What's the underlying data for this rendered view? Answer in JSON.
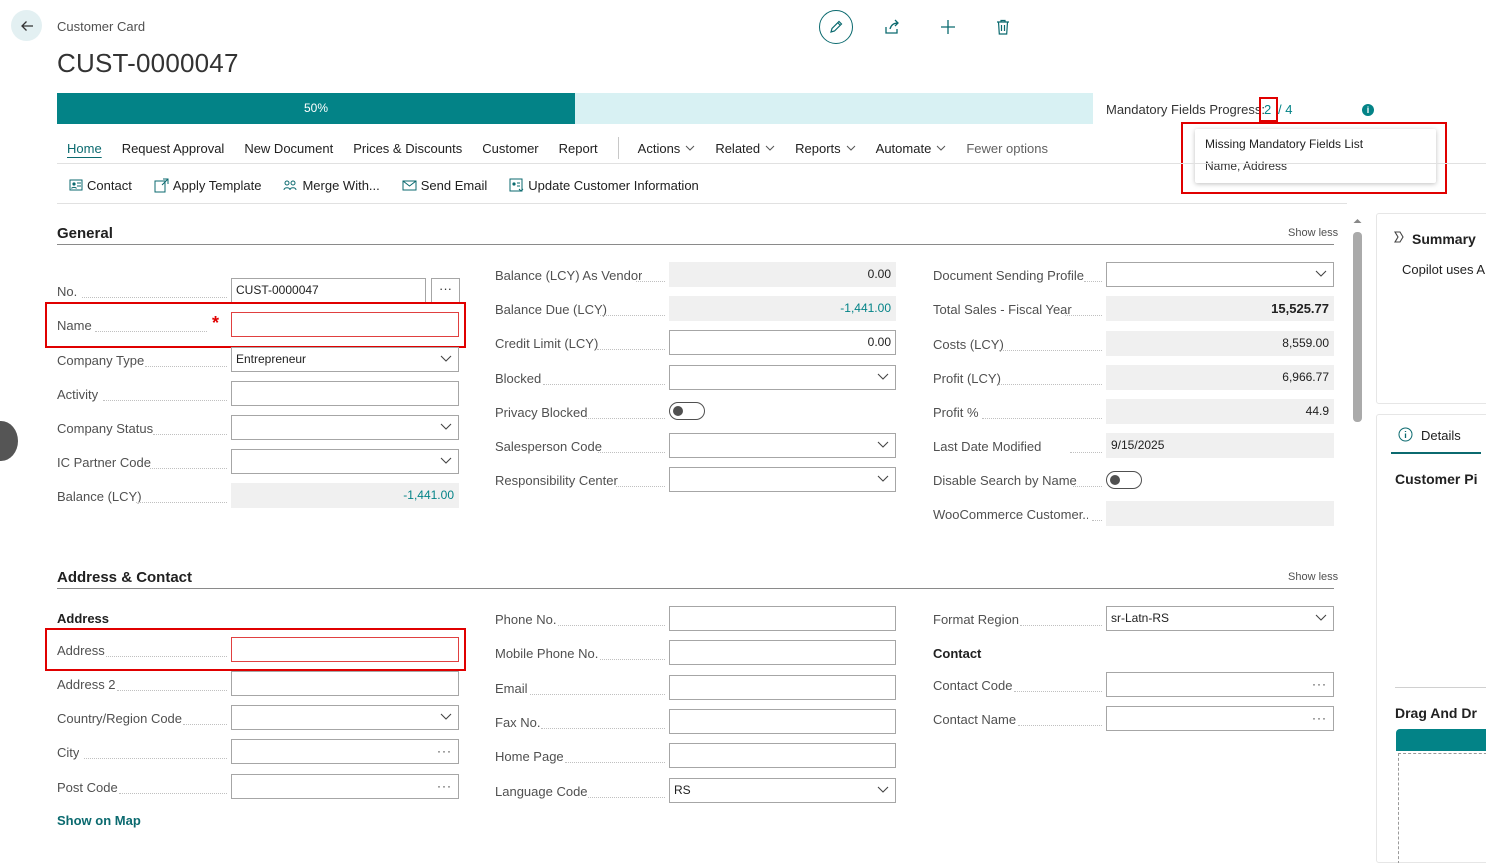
{
  "header": {
    "card_type": "Customer Card",
    "title": "CUST-0000047"
  },
  "icons": {
    "back": "arrow-left-icon",
    "edit": "pencil-icon",
    "share": "share-icon",
    "new": "plus-icon",
    "delete": "trash-icon"
  },
  "progress": {
    "percent": 50,
    "label": "50%",
    "mandatory_label": "Mandatory Fields Progress:",
    "filled": "2",
    "total": "/ 4",
    "info": "i"
  },
  "tooltip": {
    "title": "Missing Mandatory Fields List",
    "body": "Name, Address"
  },
  "tabs": {
    "home": "Home",
    "request_approval": "Request Approval",
    "new_document": "New Document",
    "prices_discounts": "Prices & Discounts",
    "customer": "Customer",
    "report": "Report",
    "actions": "Actions",
    "related": "Related",
    "reports": "Reports",
    "automate": "Automate",
    "fewer": "Fewer options"
  },
  "actions": {
    "contact": "Contact",
    "apply_template": "Apply Template",
    "merge_with": "Merge With...",
    "send_email": "Send Email",
    "update_info": "Update Customer Information"
  },
  "general": {
    "title": "General",
    "show_less": "Show less",
    "no_label": "No.",
    "no_value": "CUST-0000047",
    "more": "···",
    "name_label": "Name",
    "required": "*",
    "name_value": "",
    "company_type_label": "Company Type",
    "company_type_value": "Entrepreneur",
    "activity_label": "Activity",
    "company_status_label": "Company Status",
    "ic_partner_label": "IC Partner Code",
    "balance_label": "Balance (LCY)",
    "balance_value": "-1,441.00",
    "bal_vendor_label": "Balance (LCY) As Vendor",
    "bal_vendor_value": "0.00",
    "bal_due_label": "Balance Due (LCY)",
    "bal_due_value": "-1,441.00",
    "credit_label": "Credit Limit (LCY)",
    "credit_value": "0.00",
    "blocked_label": "Blocked",
    "privacy_label": "Privacy Blocked",
    "salesperson_label": "Salesperson Code",
    "resp_label": "Responsibility Center",
    "doc_profile_label": "Document Sending Profile",
    "total_sales_label": "Total Sales - Fiscal Year",
    "total_sales_value": "15,525.77",
    "costs_label": "Costs (LCY)",
    "costs_value": "8,559.00",
    "profit_label": "Profit (LCY)",
    "profit_value": "6,966.77",
    "profit_pct_label": "Profit %",
    "profit_pct_value": "44.9",
    "last_mod_label": "Last Date Modified",
    "last_mod_value": "9/15/2025",
    "disable_search_label": "Disable Search by Name",
    "woo_label": "WooCommerce Customer..."
  },
  "address": {
    "title": "Address & Contact",
    "show_less": "Show less",
    "address_head": "Address",
    "address_label": "Address",
    "address2_label": "Address 2",
    "country_label": "Country/Region Code",
    "city_label": "City",
    "post_label": "Post Code",
    "ellipsis": "···",
    "show_map": "Show on Map",
    "phone_label": "Phone No.",
    "mobile_label": "Mobile Phone No.",
    "email_label": "Email",
    "fax_label": "Fax No.",
    "home_label": "Home Page",
    "lang_label": "Language Code",
    "lang_value": "RS",
    "format_label": "Format Region",
    "format_value": "sr-Latn-RS",
    "contact_head": "Contact",
    "contact_code_label": "Contact Code",
    "contact_name_label": "Contact Name"
  },
  "factbox": {
    "summary": "Summary",
    "copilot": "Copilot uses AI",
    "details": "Details",
    "customer_pic": "Customer Pi",
    "drag_drop": "Drag And Dr"
  }
}
